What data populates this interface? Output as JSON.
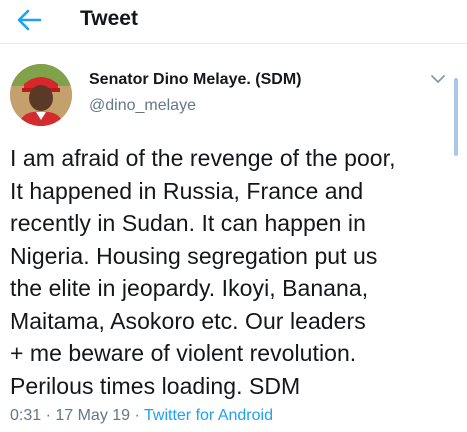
{
  "header": {
    "title": "Tweet",
    "back_icon": "arrow-left-icon",
    "accent": "#1da1f2"
  },
  "tweet": {
    "display_name": "Senator Dino Melaye. (SDM)",
    "handle": "@dino_melaye",
    "text": "I am afraid of the revenge of the poor,\nIt happened in Russia, France and\nrecently in Sudan. It can happen in\nNigeria. Housing segregation put us\nthe elite in jeopardy. Ikoyi, Banana,\nMaitama, Asokoro etc. Our leaders\n+ me beware of violent revolution.\nPerilous times loading. SDM",
    "time": "0:31",
    "sep1": " · ",
    "date": "17 May 19",
    "sep2": " · ",
    "source": "Twitter for Android",
    "menu_icon": "chevron-down-icon"
  },
  "colors": {
    "text": "#14171a",
    "secondary": "#657786",
    "link": "#1da1f2",
    "divider": "#e6ecf0"
  }
}
